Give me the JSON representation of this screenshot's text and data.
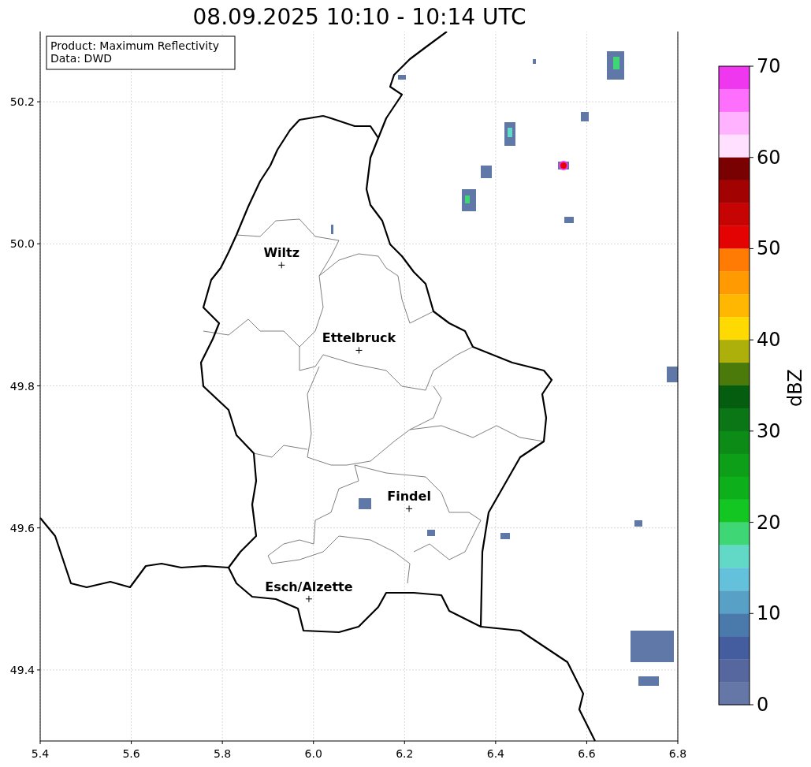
{
  "title": "08.09.2025 10:10 - 10:14 UTC",
  "info_box": [
    "Product: Maximum Reflectivity",
    "Data: DWD"
  ],
  "map": {
    "yticks": [
      "50.2",
      "50.0",
      "49.8",
      "49.6",
      "49.4"
    ],
    "xticks": [
      "5.4",
      "5.6",
      "5.8",
      "6.0",
      "6.2",
      "6.4",
      "6.6",
      "6.8"
    ],
    "cities": [
      {
        "name": "Wiltz"
      },
      {
        "name": "Ettelbruck"
      },
      {
        "name": "Findel"
      },
      {
        "name": "Esch/Alzette"
      }
    ]
  },
  "colorbar": {
    "label": "dBZ",
    "ticks": [
      "70",
      "60",
      "50",
      "40",
      "30",
      "20",
      "10",
      "0"
    ],
    "segments": [
      {
        "color": "#ee37ef"
      },
      {
        "color": "#ff6ffe"
      },
      {
        "color": "#ffb2ff"
      },
      {
        "color": "#ffe1ff"
      },
      {
        "color": "#7a0101"
      },
      {
        "color": "#a30202"
      },
      {
        "color": "#c60404"
      },
      {
        "color": "#e30303"
      },
      {
        "color": "#ff7b03"
      },
      {
        "color": "#ff9a03"
      },
      {
        "color": "#ffb702"
      },
      {
        "color": "#ffda02"
      },
      {
        "color": "#adb00a"
      },
      {
        "color": "#4b7a0a"
      },
      {
        "color": "#055e10"
      },
      {
        "color": "#0a7616"
      },
      {
        "color": "#0c8c17"
      },
      {
        "color": "#0e9f18"
      },
      {
        "color": "#0db01b"
      },
      {
        "color": "#13c621"
      },
      {
        "color": "#3fd675"
      },
      {
        "color": "#62d8c6"
      },
      {
        "color": "#63c1dc"
      },
      {
        "color": "#58a0c6"
      },
      {
        "color": "#4a79ac"
      },
      {
        "color": "#445d9e"
      },
      {
        "color": "#5667a0"
      },
      {
        "color": "#6577a6"
      }
    ]
  }
}
